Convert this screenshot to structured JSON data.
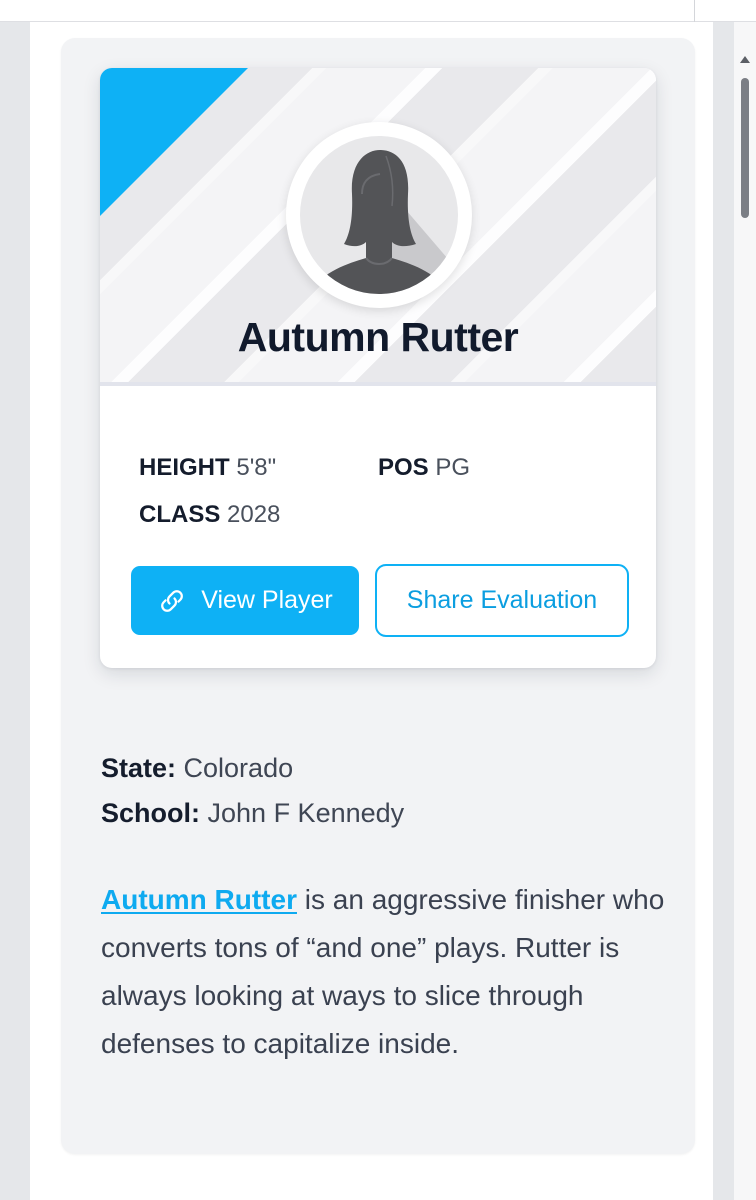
{
  "player": {
    "name": "Autumn Rutter",
    "avatar_icon": "person-silhouette-icon",
    "stats": {
      "height_label": "HEIGHT",
      "height_value": "5'8\"",
      "pos_label": "POS",
      "pos_value": "PG",
      "class_label": "CLASS",
      "class_value": "2028"
    }
  },
  "actions": {
    "view_player_label": "View Player",
    "view_player_icon": "link-icon",
    "share_evaluation_label": "Share Evaluation"
  },
  "details": {
    "state_label": "State:",
    "state_value": "Colorado",
    "school_label": "School:",
    "school_value": "John F Kennedy"
  },
  "bio": {
    "link_text": "Autumn Rutter",
    "text": " is an aggressive finisher who converts tons of “and one” plays. Rutter is always looking at ways to slice through defenses to capitalize inside."
  },
  "colors": {
    "accent": "#0eb1f5",
    "card_background": "#f2f3f5",
    "heading": "#111a2c"
  }
}
